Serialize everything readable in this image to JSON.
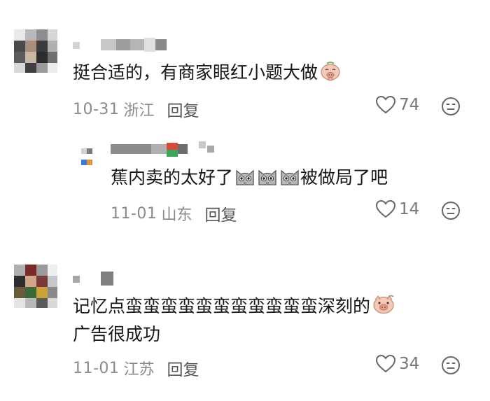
{
  "comments": [
    {
      "text": "挺合适的，有商家眼红小题大做",
      "emoji": "pig-praying-icon",
      "date": "10-31",
      "location": "浙江",
      "reply_label": "回复",
      "likes": "74"
    },
    {
      "text_before": "蕉内卖的太好了",
      "emojis": [
        "cat-face-icon",
        "cat-face-icon",
        "cat-face-icon"
      ],
      "text_after": "被做局了吧",
      "date": "11-01",
      "location": "山东",
      "reply_label": "回复",
      "likes": "14"
    },
    {
      "line1": "记忆点蛮蛮蛮蛮蛮蛮蛮蛮蛮蛮蛮深刻的",
      "emoji": "pig-face-icon",
      "line2": "广告很成功",
      "date": "11-01",
      "location": "江苏",
      "reply_label": "回复",
      "likes": "34"
    }
  ],
  "colors": {
    "text": "#161616",
    "meta": "#8a8a8a",
    "icon": "#666666"
  }
}
